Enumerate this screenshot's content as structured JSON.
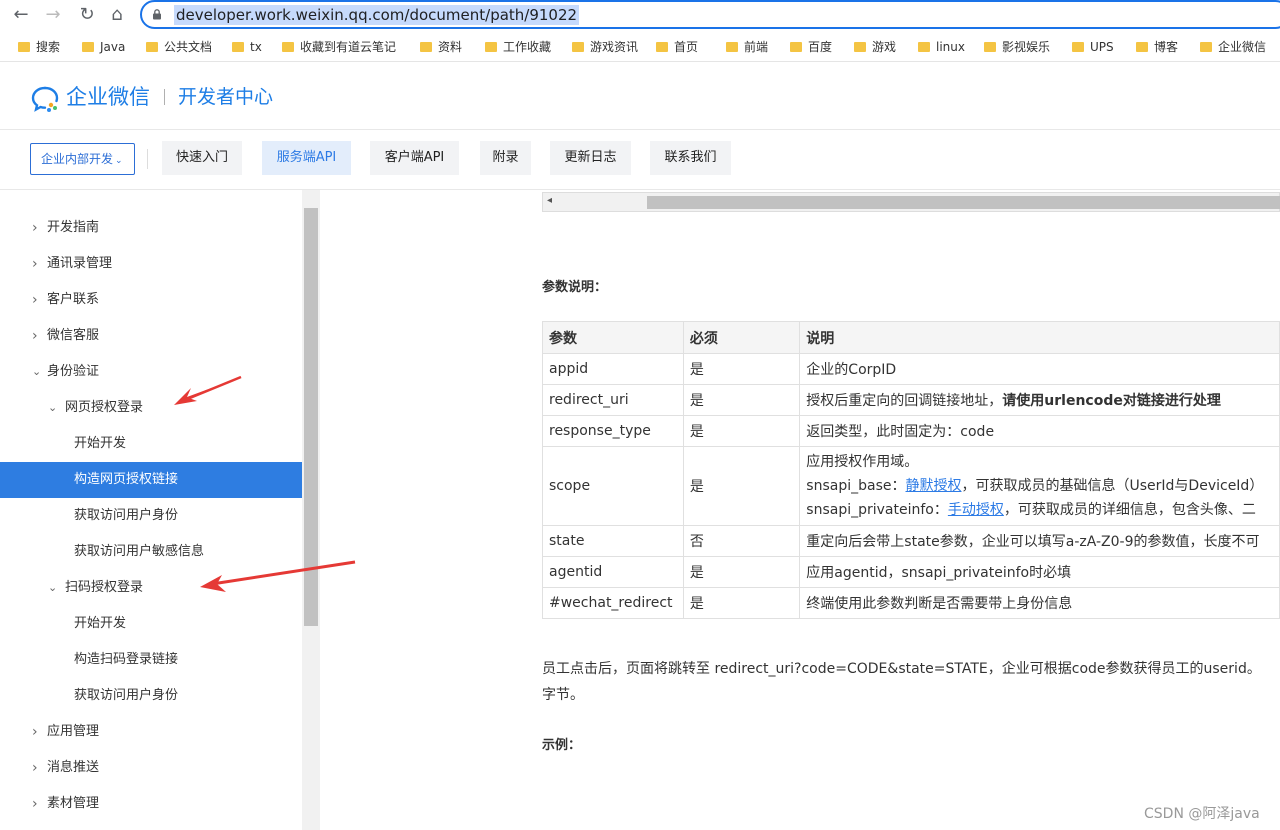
{
  "browser": {
    "url": "developer.work.weixin.qq.com/document/path/91022",
    "bookmarks": [
      "搜索",
      "Java",
      "公共文档",
      "tx",
      "收藏到有道云笔记",
      "资料",
      "工作收藏",
      "游戏资讯",
      "首页",
      "前端",
      "百度",
      "游戏",
      "linux",
      "影视娱乐",
      "UPS",
      "博客",
      "企业微信"
    ]
  },
  "header": {
    "brand": "企业微信",
    "subtitle": "开发者中心"
  },
  "nav": {
    "dropdown": "企业内部开发",
    "tabs": [
      "快速入门",
      "服务端API",
      "客户端API",
      "附录",
      "更新日志",
      "联系我们"
    ],
    "active_tab": "服务端API"
  },
  "sidebar": {
    "items": [
      {
        "label": "开发指南",
        "level": 0,
        "expanded": false
      },
      {
        "label": "通讯录管理",
        "level": 0,
        "expanded": false
      },
      {
        "label": "客户联系",
        "level": 0,
        "expanded": false
      },
      {
        "label": "微信客服",
        "level": 0,
        "expanded": false
      },
      {
        "label": "身份验证",
        "level": 0,
        "expanded": true
      },
      {
        "label": "网页授权登录",
        "level": 1,
        "expanded": true
      },
      {
        "label": "开始开发",
        "level": 2
      },
      {
        "label": "构造网页授权链接",
        "level": 2,
        "active": true
      },
      {
        "label": "获取访问用户身份",
        "level": 2
      },
      {
        "label": "获取访问用户敏感信息",
        "level": 2
      },
      {
        "label": "扫码授权登录",
        "level": 1,
        "expanded": true
      },
      {
        "label": "开始开发",
        "level": 2
      },
      {
        "label": "构造扫码登录链接",
        "level": 2
      },
      {
        "label": "获取访问用户身份",
        "level": 2
      },
      {
        "label": "应用管理",
        "level": 0,
        "expanded": false
      },
      {
        "label": "消息推送",
        "level": 0,
        "expanded": false
      },
      {
        "label": "素材管理",
        "level": 0,
        "expanded": false
      }
    ]
  },
  "content": {
    "params_heading": "参数说明：",
    "table": {
      "headers": [
        "参数",
        "必须",
        "说明"
      ],
      "rows": [
        {
          "param": "appid",
          "required": "是",
          "desc": "企业的CorpID"
        },
        {
          "param": "redirect_uri",
          "required": "是",
          "desc": "授权后重定向的回调链接地址，",
          "desc_bold": "请使用urlencode对链接进行处理"
        },
        {
          "param": "response_type",
          "required": "是",
          "desc": "返回类型，此时固定为：code"
        },
        {
          "param": "scope",
          "required": "是",
          "desc": "应用授权作用域。",
          "line2_prefix": "snsapi_base：",
          "line2_link": "静默授权",
          "line2_rest": "，可获取成员的基础信息（UserId与DeviceId）",
          "line3_prefix": "snsapi_privateinfo：",
          "line3_link": "手动授权",
          "line3_rest": "，可获取成员的详细信息，包含头像、二"
        },
        {
          "param": "state",
          "required": "否",
          "desc": "重定向后会带上state参数，企业可以填写a-zA-Z0-9的参数值，长度不可"
        },
        {
          "param": "agentid",
          "required": "是",
          "desc": "应用agentid，snsapi_privateinfo时必填"
        },
        {
          "param": "#wechat_redirect",
          "required": "是",
          "desc": "终端使用此参数判断是否需要带上身份信息"
        }
      ]
    },
    "para_line1": "员工点击后，页面将跳转至 redirect_uri?code=CODE&state=STATE，企业可根据code参数获得员工的userid。",
    "para_line2": "字节。",
    "example_heading": "示例："
  },
  "watermark": "CSDN @阿泽java",
  "colors": {
    "accent": "#2e7de1",
    "annotation_arrow": "#e53935"
  }
}
